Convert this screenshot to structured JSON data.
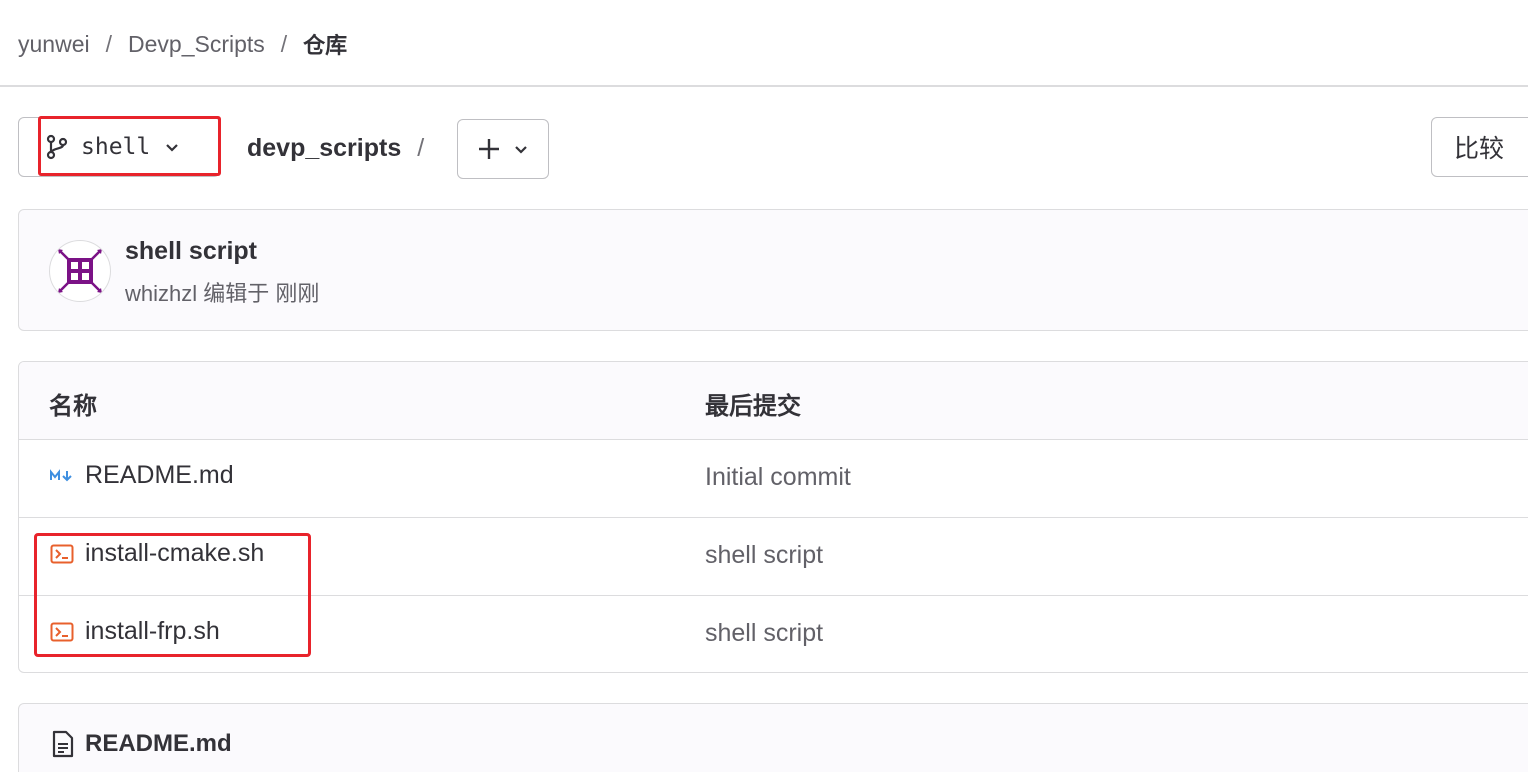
{
  "breadcrumb": {
    "items": [
      "yunwei",
      "Devp_Scripts"
    ],
    "separator": "/",
    "current": "仓库"
  },
  "toolbar": {
    "branch_name": "shell",
    "project_name": "devp_scripts",
    "path_separator": "/",
    "compare_label": "比较"
  },
  "commit": {
    "title": "shell script",
    "author": "whizhzl",
    "action": "编辑于",
    "time": "刚刚"
  },
  "table": {
    "headers": {
      "name": "名称",
      "last_commit": "最后提交"
    },
    "rows": [
      {
        "name": "README.md",
        "commit": "Initial commit",
        "icon": "markdown-icon"
      },
      {
        "name": "install-cmake.sh",
        "commit": "shell script",
        "icon": "terminal-file-icon"
      },
      {
        "name": "install-frp.sh",
        "commit": "shell script",
        "icon": "terminal-file-icon"
      }
    ]
  },
  "readme": {
    "title": "README.md"
  },
  "colors": {
    "highlight": "#e8232b",
    "avatar": "#7b1286",
    "markdown_icon": "#3f8fe0",
    "shell_icon": "#e8602c"
  }
}
